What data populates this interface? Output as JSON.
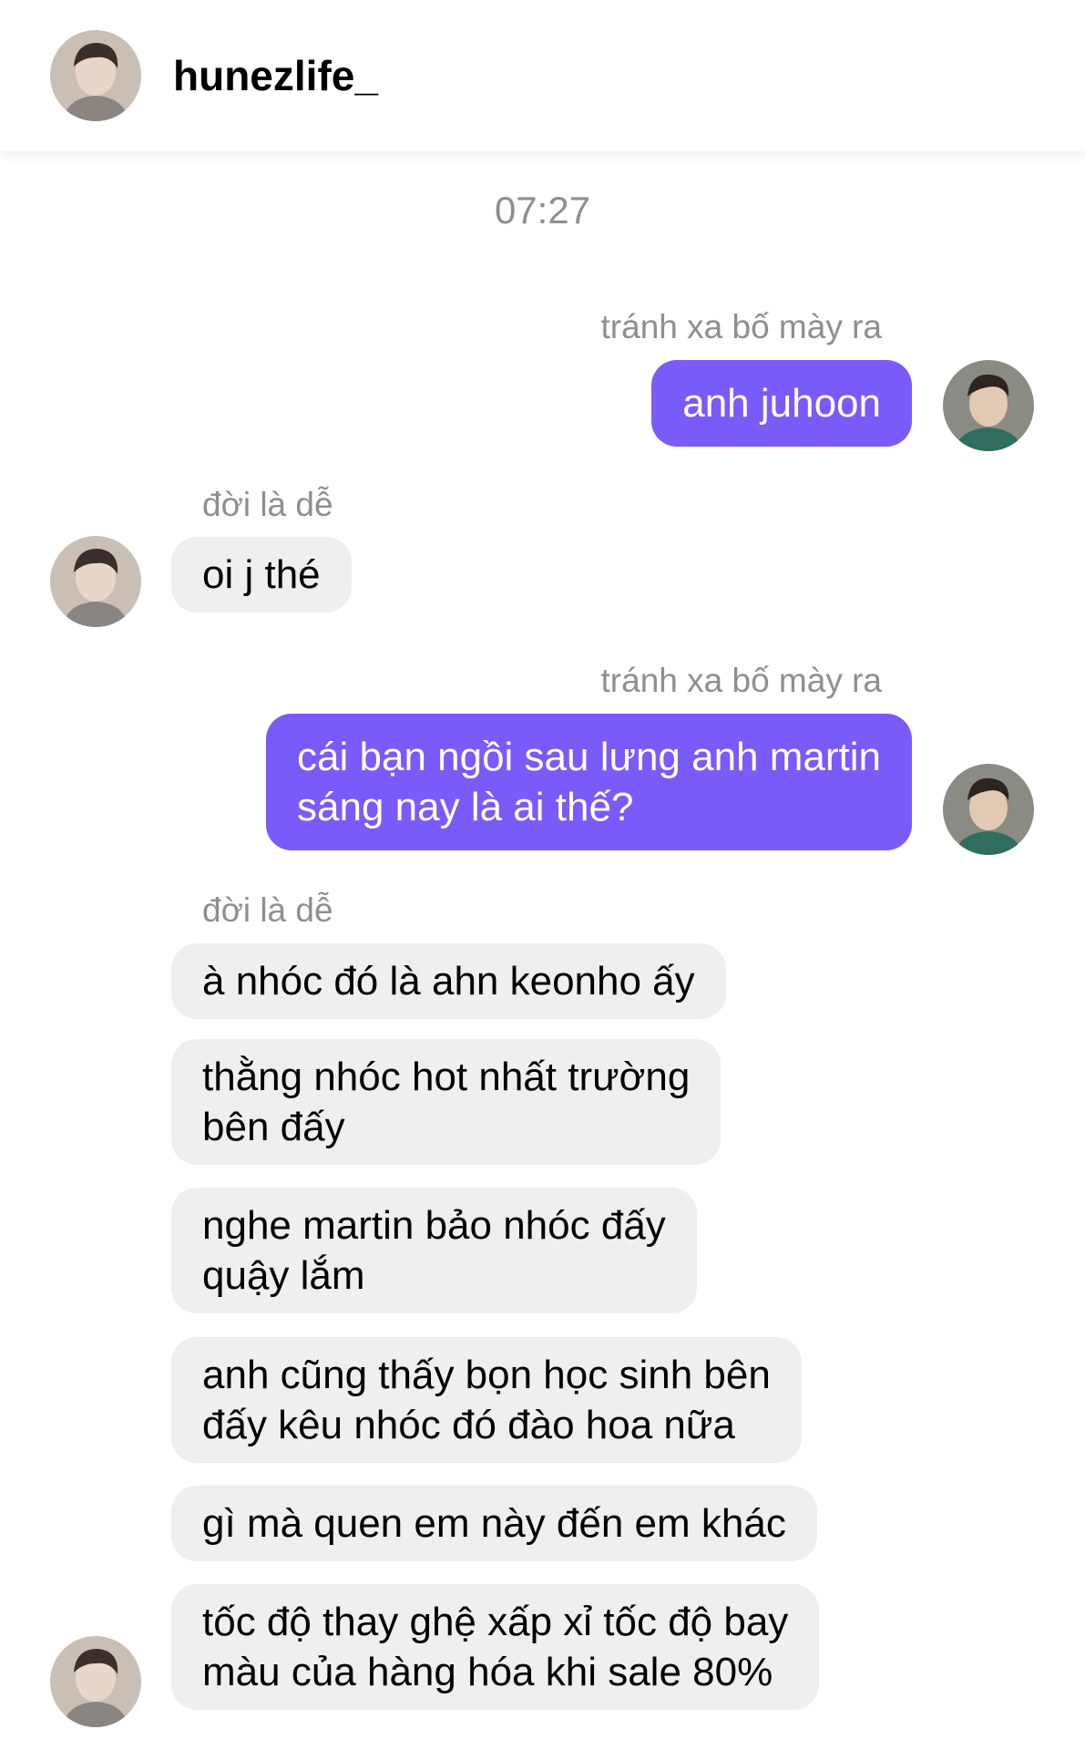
{
  "header": {
    "username": "hunezlife_",
    "avatar_icon": "profile-avatar-icon"
  },
  "timestamp": "07:27",
  "colors": {
    "outgoing_bubble": "#7a5af8",
    "incoming_bubble": "#efeff0",
    "meta_text": "#8e8e93"
  },
  "messages": [
    {
      "direction": "outgoing",
      "sender_label": "tránh xa bố mày ra",
      "lines": [
        "anh juhoon"
      ]
    },
    {
      "direction": "incoming",
      "sender_label": "đời là dễ",
      "lines": [
        "oi j thé"
      ]
    },
    {
      "direction": "outgoing",
      "sender_label": "tránh xa bố mày ra",
      "lines": [
        "cái bạn ngồi sau lưng anh martin",
        "sáng nay là ai thế?"
      ]
    },
    {
      "direction": "incoming",
      "sender_label": "đời là dễ",
      "lines": [
        "à nhóc đó là ahn keonho ấy"
      ]
    },
    {
      "direction": "incoming",
      "lines": [
        "thằng nhóc hot nhất trường",
        "bên đấy"
      ]
    },
    {
      "direction": "incoming",
      "lines": [
        "nghe martin bảo nhóc đấy",
        "quậy lắm"
      ]
    },
    {
      "direction": "incoming",
      "lines": [
        "anh cũng thấy bọn học sinh bên",
        "đấy kêu nhóc đó đào hoa nữa"
      ]
    },
    {
      "direction": "incoming",
      "lines": [
        "gì mà quen em này đến em khác"
      ]
    },
    {
      "direction": "incoming",
      "lines": [
        "tốc độ thay ghệ xấp xỉ tốc độ bay",
        "màu của hàng hóa khi sale 80%"
      ]
    }
  ]
}
